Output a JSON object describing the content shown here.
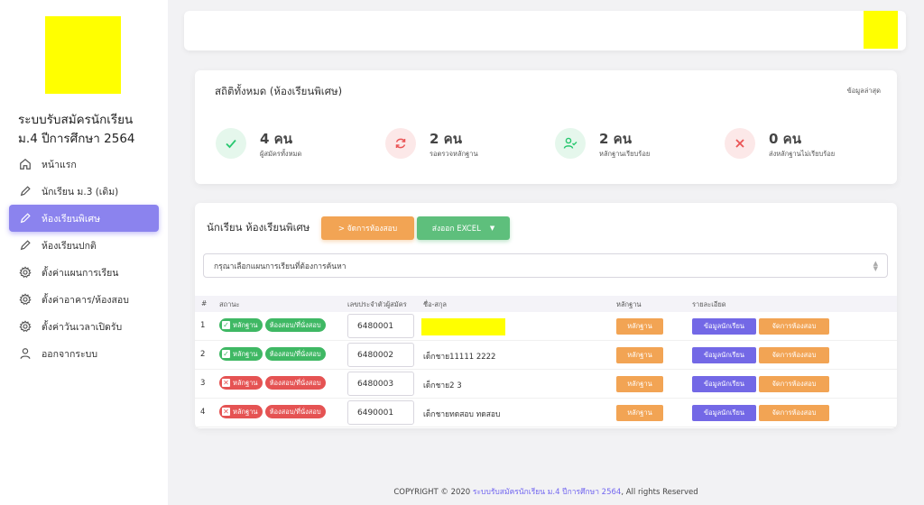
{
  "app": {
    "title_line1": "ระบบรับสมัครนักเรียน",
    "title_line2": "ม.4 ปีการศึกษา 2564"
  },
  "nav": [
    {
      "label": "หน้าแรก",
      "icon": "home-icon"
    },
    {
      "label": "นักเรียน ม.3 (เดิม)",
      "icon": "pencil-icon"
    },
    {
      "label": "ห้องเรียนพิเศษ",
      "icon": "pencil-icon",
      "active": true
    },
    {
      "label": "ห้องเรียนปกติ",
      "icon": "pencil-icon"
    },
    {
      "label": "ตั้งค่าแผนการเรียน",
      "icon": "gear-icon"
    },
    {
      "label": "ตั้งค่าอาคาร/ห้องสอบ",
      "icon": "gear-icon"
    },
    {
      "label": "ตั้งค่าวันเวลาเปิดรับ",
      "icon": "gear-icon"
    },
    {
      "label": "ออกจากระบบ",
      "icon": "user-icon"
    }
  ],
  "stats": {
    "title": "สถิติทั้งหมด (ห้องเรียนพิเศษ)",
    "latest": "ข้อมูลล่าสุด",
    "items": [
      {
        "value": "4 คน",
        "label": "ผู้สมัครทั้งหมด",
        "icon": "check-icon",
        "color": "#28c76f"
      },
      {
        "value": "2 คน",
        "label": "รอตรวจหลักฐาน",
        "icon": "refresh-icon",
        "color": "#ea5455"
      },
      {
        "value": "2 คน",
        "label": "หลักฐานเรียบร้อย",
        "icon": "user-check-icon",
        "color": "#28c76f"
      },
      {
        "value": "0 คน",
        "label": "ส่งหลักฐานไม่เรียบร้อย",
        "icon": "x-icon",
        "color": "#ea5455"
      }
    ]
  },
  "students": {
    "title": "นักเรียน ห้องเรียนพิเศษ",
    "manage_button": "> จัดการห้องสอบ",
    "export_button": "ส่งออก EXCEL",
    "plan_select_placeholder": "กรุณาเลือกแผนการเรียนที่ต้องการค้นหา",
    "columns": [
      "#",
      "สถานะ",
      "เลขประจำตัวผู้สมัคร",
      "ชื่อ-สกุล",
      "หลักฐาน",
      "รายละเอียด"
    ],
    "badge_doc": "หลักฐาน",
    "badge_room": "ห้องสอบ/ที่นั่งสอบ",
    "btn_doc": "หลักฐาน",
    "btn_info": "ข้อมูลนักเรียน",
    "btn_room": "จัดการห้องสอบ",
    "rows": [
      {
        "index": "1",
        "status": "ok",
        "app_no": "6480001",
        "name": ""
      },
      {
        "index": "2",
        "status": "ok",
        "app_no": "6480002",
        "name": "เด็กชาย11111 2222"
      },
      {
        "index": "3",
        "status": "bad",
        "app_no": "6480003",
        "name": "เด็กชาย2 3"
      },
      {
        "index": "4",
        "status": "bad",
        "app_no": "6490001",
        "name": "เด็กชายทดสอบ ทดสอบ"
      }
    ]
  },
  "footer": {
    "prefix": "COPYRIGHT © 2020 ",
    "link": "ระบบรับสมัครนักเรียน ม.4 ปีการศึกษา 2564",
    "suffix": ", All rights Reserved"
  }
}
